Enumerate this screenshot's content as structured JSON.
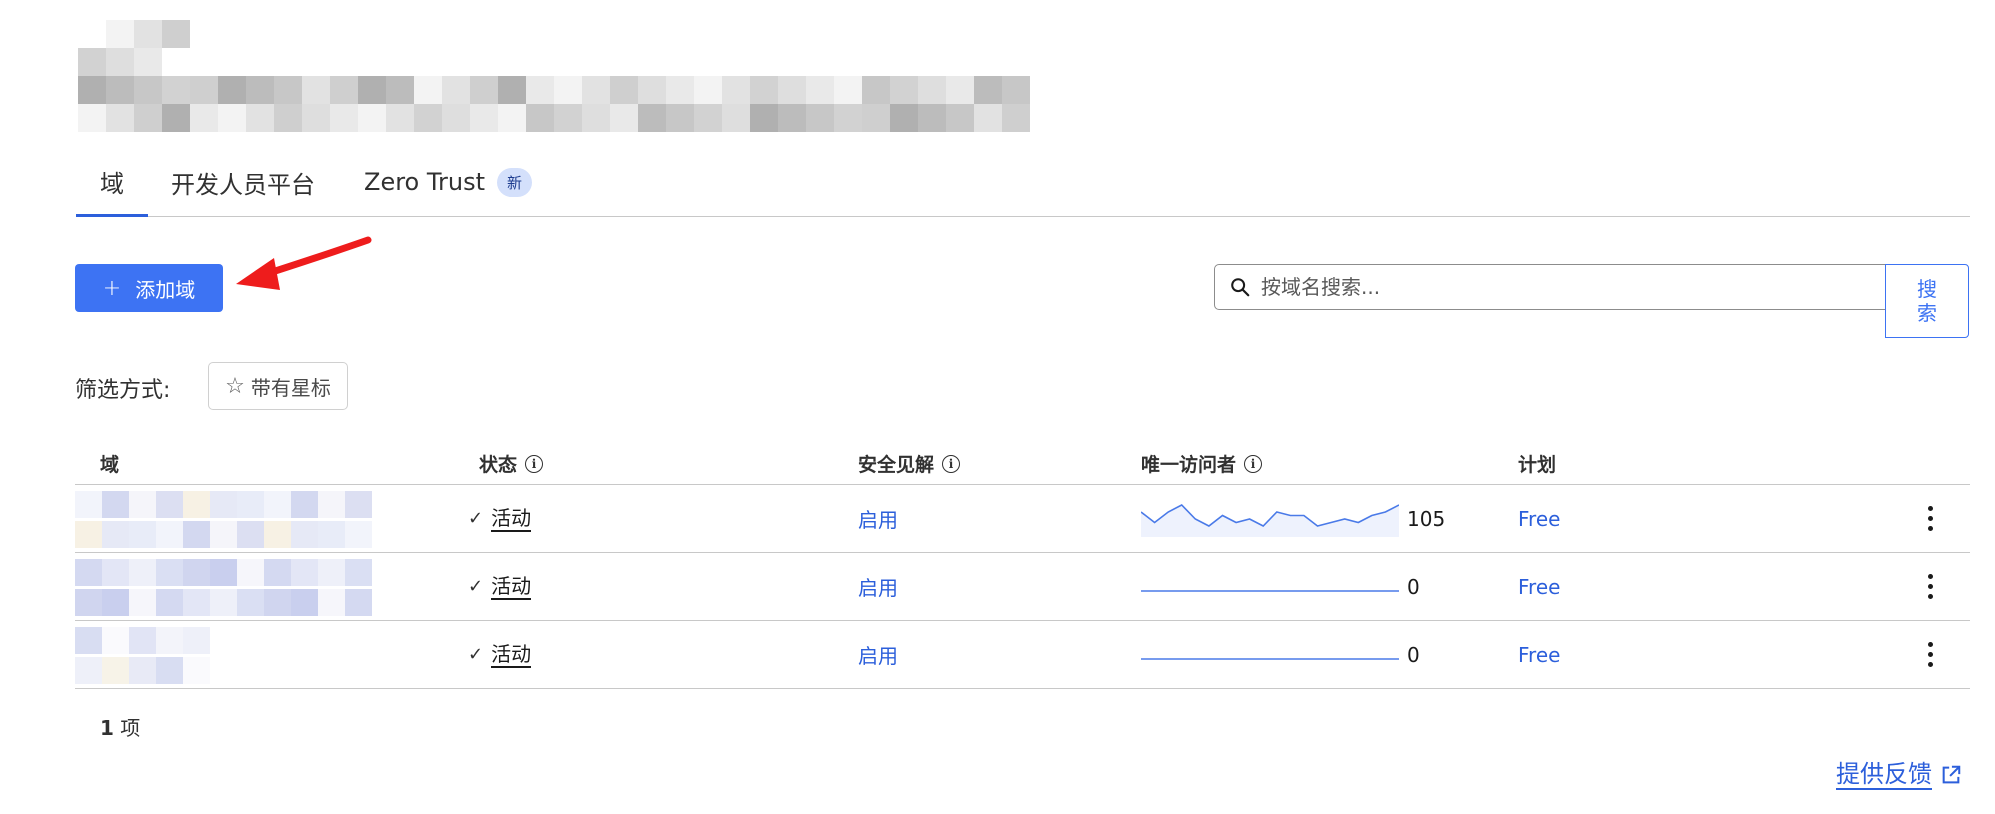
{
  "tabs": [
    {
      "label": "域",
      "active": true
    },
    {
      "label": "开发人员平台",
      "active": false
    },
    {
      "label": "Zero Trust",
      "badge": "新",
      "active": false
    }
  ],
  "toolbar": {
    "add_button_icon": "plus-icon",
    "add_button_label": "添加域"
  },
  "search": {
    "placeholder": "按域名搜索...",
    "button_label": "搜索",
    "icon": "search-icon"
  },
  "filter": {
    "label": "筛选方式:",
    "chip_icon": "star-outline-icon",
    "chip_label": "带有星标"
  },
  "table": {
    "columns": [
      "域",
      "状态",
      "安全见解",
      "唯一访问者",
      "计划"
    ],
    "rows": [
      {
        "status": "活动",
        "insights": "启用",
        "visitors": "105",
        "plan": "Free",
        "sparkline": [
          6,
          3,
          6,
          8,
          4,
          2,
          5,
          3,
          4,
          2,
          6,
          5,
          5,
          2,
          3,
          4,
          3,
          5,
          6,
          8
        ]
      },
      {
        "status": "活动",
        "insights": "启用",
        "visitors": "0",
        "plan": "Free",
        "sparkline": [
          0,
          0
        ]
      },
      {
        "status": "活动",
        "insights": "启用",
        "visitors": "0",
        "plan": "Free",
        "sparkline": [
          0,
          0
        ]
      }
    ]
  },
  "pagination": {
    "count": "1",
    "unit": "项"
  },
  "feedback": {
    "label": "提供反馈",
    "icon": "external-link-icon"
  },
  "colors": {
    "accent": "#3d73f3",
    "link": "#2c5fdb",
    "annotation_arrow": "#ee1c1c"
  }
}
